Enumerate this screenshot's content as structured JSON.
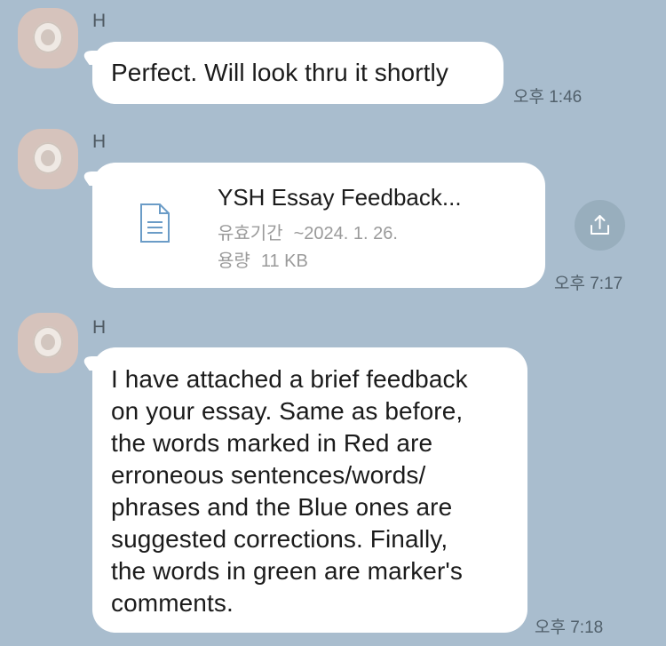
{
  "messages": [
    {
      "sender": "H",
      "text": "Perfect. Will look thru it shortly",
      "time": "오후 1:46"
    },
    {
      "sender": "H",
      "file": {
        "name": "YSH Essay Feedback...",
        "expiry_label": "유효기간",
        "expiry_value": "~2024. 1. 26.",
        "size_label": "용량",
        "size_value": "11 KB",
        "icon": "document-icon"
      },
      "share_icon": "share-upload-icon",
      "time": "오후 7:17"
    },
    {
      "sender": "H",
      "lines": [
        "I have attached a brief feedback",
        "on your essay. Same as before,",
        "the words marked in Red are",
        "erroneous sentences/words/",
        "phrases and the Blue ones are",
        "suggested corrections. Finally,",
        "the words in green are marker's",
        "comments."
      ],
      "time": "오후 7:18"
    }
  ],
  "colors": {
    "background": "#a9bdce",
    "bubble": "#ffffff",
    "share_button": "#98aebd"
  }
}
